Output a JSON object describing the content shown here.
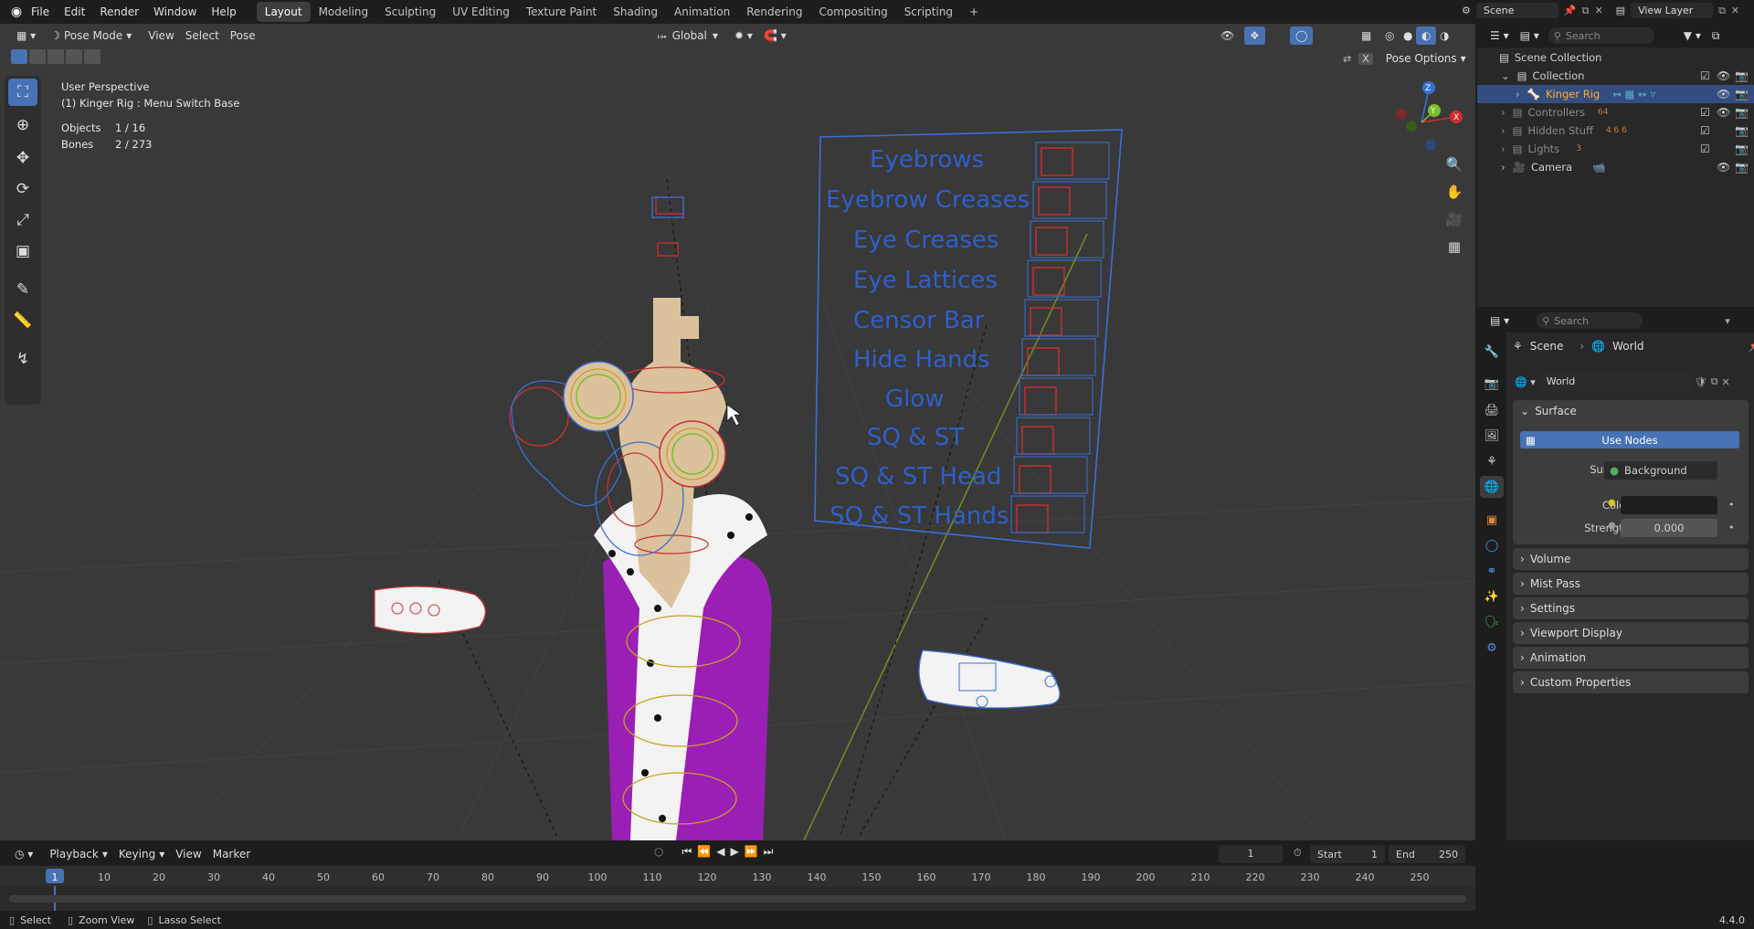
{
  "topbar": {
    "menus": [
      "File",
      "Edit",
      "Render",
      "Window",
      "Help"
    ],
    "workspaces": [
      "Layout",
      "Modeling",
      "Sculpting",
      "UV Editing",
      "Texture Paint",
      "Shading",
      "Animation",
      "Rendering",
      "Compositing",
      "Scripting"
    ],
    "add_tab": "+",
    "scene_name": "Scene",
    "view_layer": "View Layer"
  },
  "viewport": {
    "mode": "Pose Mode",
    "menus": [
      "View",
      "Select",
      "Pose"
    ],
    "orientation": "Global",
    "pose_options": "Pose Options",
    "perspective": "User Perspective",
    "active": "(1) Kinger Rig : Menu Switch Base",
    "objects_label": "Objects",
    "objects_value": "1 / 16",
    "bones_label": "Bones",
    "bones_value": "2 / 273",
    "menu_board": [
      "Eyebrows",
      "Eyebrow Creases",
      "Eye Creases",
      "Eye Lattices",
      "Censor Bar",
      "Hide Hands",
      "Glow",
      "SQ & ST",
      "SQ & ST Head",
      "SQ & ST Hands"
    ],
    "colors": {
      "bg": "#393939",
      "board": "#3a6fd8",
      "bone_red": "#cc3030",
      "robe": "#9a1fb4"
    }
  },
  "outliner": {
    "search_placeholder": "Search",
    "scene_collection": "Scene Collection",
    "items": [
      {
        "label": "Collection",
        "depth": 1,
        "selected": false
      },
      {
        "label": "Kinger Rig",
        "depth": 2,
        "selected": true
      },
      {
        "label": "Controllers",
        "depth": 2,
        "selected": false,
        "badge": "64"
      },
      {
        "label": "Hidden Stuff",
        "depth": 2,
        "selected": false,
        "badge": "4 6 6"
      },
      {
        "label": "Lights",
        "depth": 2,
        "selected": false,
        "badge": "3"
      },
      {
        "label": "Camera",
        "depth": 2,
        "selected": false
      }
    ]
  },
  "properties": {
    "search_placeholder": "Search",
    "breadcrumb_scene": "Scene",
    "breadcrumb_world": "World",
    "world_name": "World",
    "surface_panel": "Surface",
    "use_nodes": "Use Nodes",
    "surface_label": "Surface",
    "surface_value": "Background",
    "color_label": "Color",
    "strength_label": "Strength",
    "strength_value": "0.000",
    "panels": [
      "Volume",
      "Mist Pass",
      "Settings",
      "Viewport Display",
      "Animation",
      "Custom Properties"
    ]
  },
  "timeline": {
    "menus": [
      "Playback",
      "Keying",
      "View",
      "Marker"
    ],
    "current_frame": "1",
    "start_label": "Start",
    "start_value": "1",
    "end_label": "End",
    "end_value": "250",
    "ticks": [
      "1",
      "10",
      "20",
      "30",
      "40",
      "50",
      "60",
      "70",
      "80",
      "90",
      "100",
      "110",
      "120",
      "130",
      "140",
      "150",
      "160",
      "170",
      "180",
      "190",
      "200",
      "210",
      "220",
      "230",
      "240",
      "250"
    ]
  },
  "statusbar": {
    "select": "Select",
    "zoom": "Zoom View",
    "lasso": "Lasso Select",
    "version": "4.4.0"
  }
}
